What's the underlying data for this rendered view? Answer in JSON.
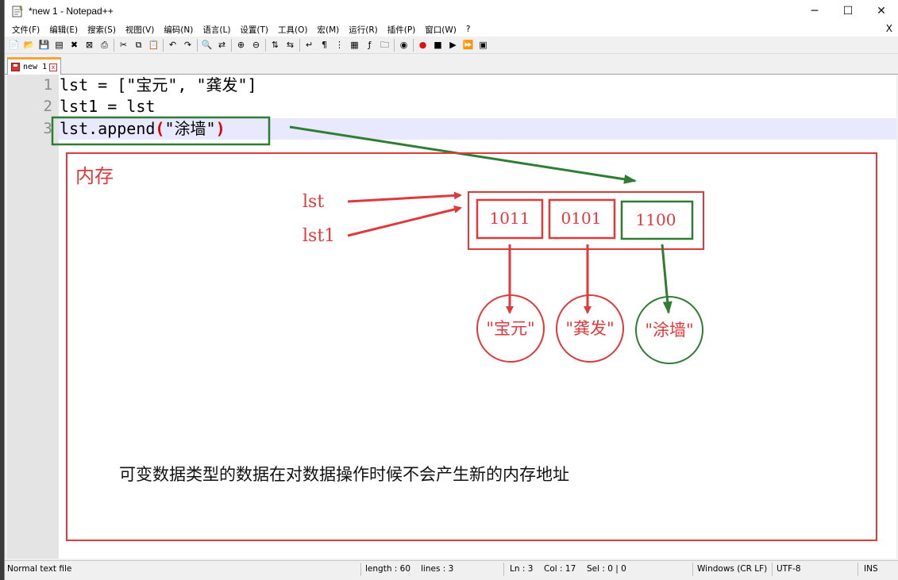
{
  "window": {
    "title": "*new 1 - Notepad++",
    "minimize": "─",
    "maximize": "☐",
    "close": "✕"
  },
  "menu": {
    "items": [
      "文件(F)",
      "编辑(E)",
      "搜索(S)",
      "视图(V)",
      "编码(N)",
      "语言(L)",
      "设置(T)",
      "工具(O)",
      "宏(M)",
      "运行(R)",
      "插件(P)",
      "窗口(W)",
      "?"
    ],
    "close_x": "X"
  },
  "toolbar_icons": [
    "new-file-icon",
    "open-file-icon",
    "save-icon",
    "save-all-icon",
    "close-icon",
    "close-all-icon",
    "print-icon",
    "cut-icon",
    "copy-icon",
    "paste-icon",
    "undo-icon",
    "redo-icon",
    "find-icon",
    "replace-icon",
    "zoom-in-icon",
    "zoom-out-icon",
    "sync-v-icon",
    "sync-h-icon",
    "wrap-icon",
    "all-chars-icon",
    "indent-guide-icon",
    "doc-map-icon",
    "function-list-icon",
    "folder-workspace-icon",
    "monitor-icon",
    "record-macro-icon",
    "stop-macro-icon",
    "play-macro-icon",
    "run-macro-multiple-icon",
    "save-macro-icon"
  ],
  "tab": {
    "label": "new 1",
    "close": "x"
  },
  "editor": {
    "line_numbers": [
      "1",
      "2",
      "3"
    ],
    "line1": "lst = [\"宝元\", \"龚发\"]",
    "line2": "lst1 = lst",
    "line3_pre": "lst.append",
    "line3_lparen": "(",
    "line3_arg": "\"涂墙\"",
    "line3_rparen": ")"
  },
  "annotation": {
    "memory_label": "内存",
    "var1": "lst",
    "var2": "lst1",
    "addresses": [
      "1011",
      "0101",
      "1100"
    ],
    "values": [
      "\"宝元\"",
      "\"龚发\"",
      "\"涂墙\""
    ],
    "caption": "可变数据类型的数据在对数据操作时候不会产生新的内存地址",
    "colors": {
      "red": "#e0393b",
      "green": "#2e7d32"
    }
  },
  "status": {
    "mode": "Normal text file",
    "length": "length : 60",
    "lines": "lines : 3",
    "ln": "Ln : 3",
    "col": "Col : 17",
    "sel": "Sel : 0 | 0",
    "eol": "Windows (CR LF)",
    "encoding": "UTF-8",
    "ins": "INS"
  }
}
